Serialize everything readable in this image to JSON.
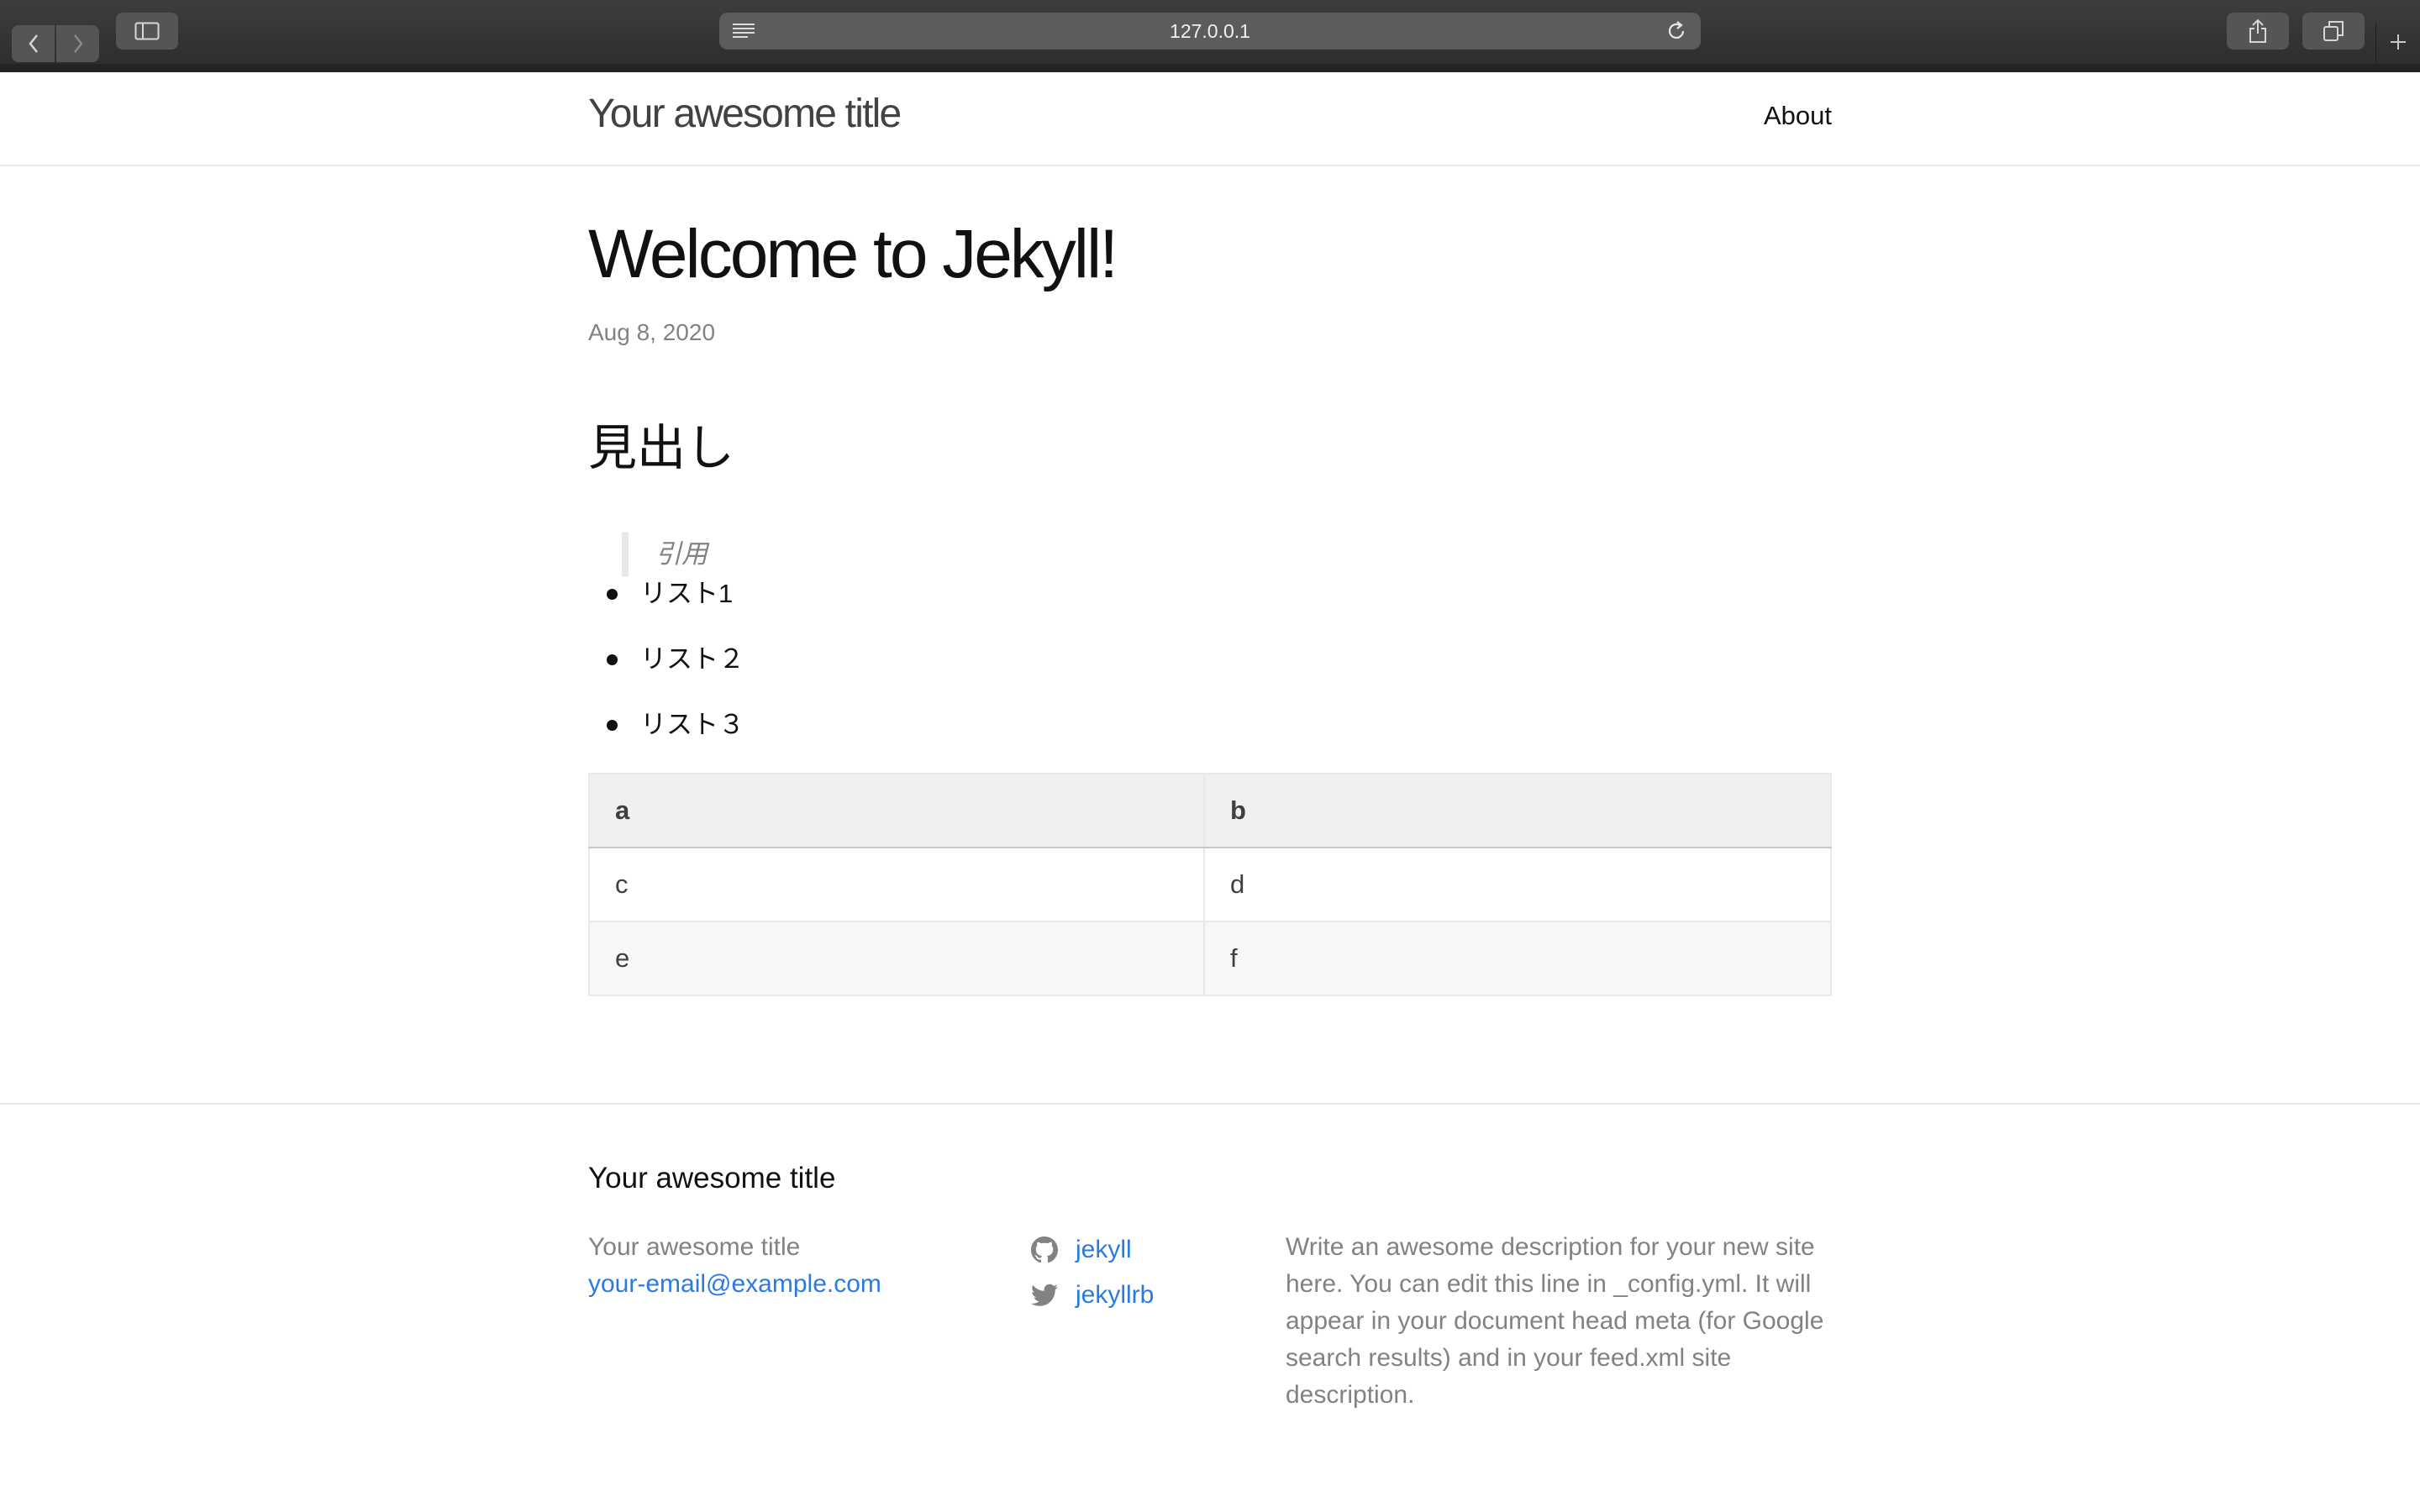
{
  "browser": {
    "url": "127.0.0.1",
    "icons": {
      "back": "chevron-left-icon",
      "forward": "chevron-right-icon",
      "sidebar": "sidebar-icon",
      "reader": "reader-icon",
      "reload": "reload-icon",
      "share": "share-icon",
      "tabs": "tabs-overview-icon",
      "new_tab": "plus-icon"
    }
  },
  "header": {
    "site_title": "Your awesome title",
    "nav": [
      {
        "label": "About"
      }
    ]
  },
  "post": {
    "title": "Welcome to Jekyll!",
    "date": "Aug 8, 2020",
    "heading": "見出し",
    "quote": "引用",
    "list": [
      "リスト1",
      "リスト２",
      "リスト３"
    ],
    "table": {
      "headers": [
        "a",
        "b"
      ],
      "rows": [
        [
          "c",
          "d"
        ],
        [
          "e",
          "f"
        ]
      ]
    }
  },
  "footer": {
    "heading": "Your awesome title",
    "name": "Your awesome title",
    "email": "your-email@example.com",
    "social": [
      {
        "icon": "github-icon",
        "label": "jekyll"
      },
      {
        "icon": "twitter-icon",
        "label": "jekyllrb"
      }
    ],
    "description": "Write an awesome description for your new site here. You can edit this line in _config.yml. It will appear in your document head meta (for Google search results) and in your feed.xml site description."
  },
  "colors": {
    "link": "#2a7ae2",
    "muted": "#828282",
    "border": "#e8e8e8",
    "chrome": "#2e2e2e"
  }
}
